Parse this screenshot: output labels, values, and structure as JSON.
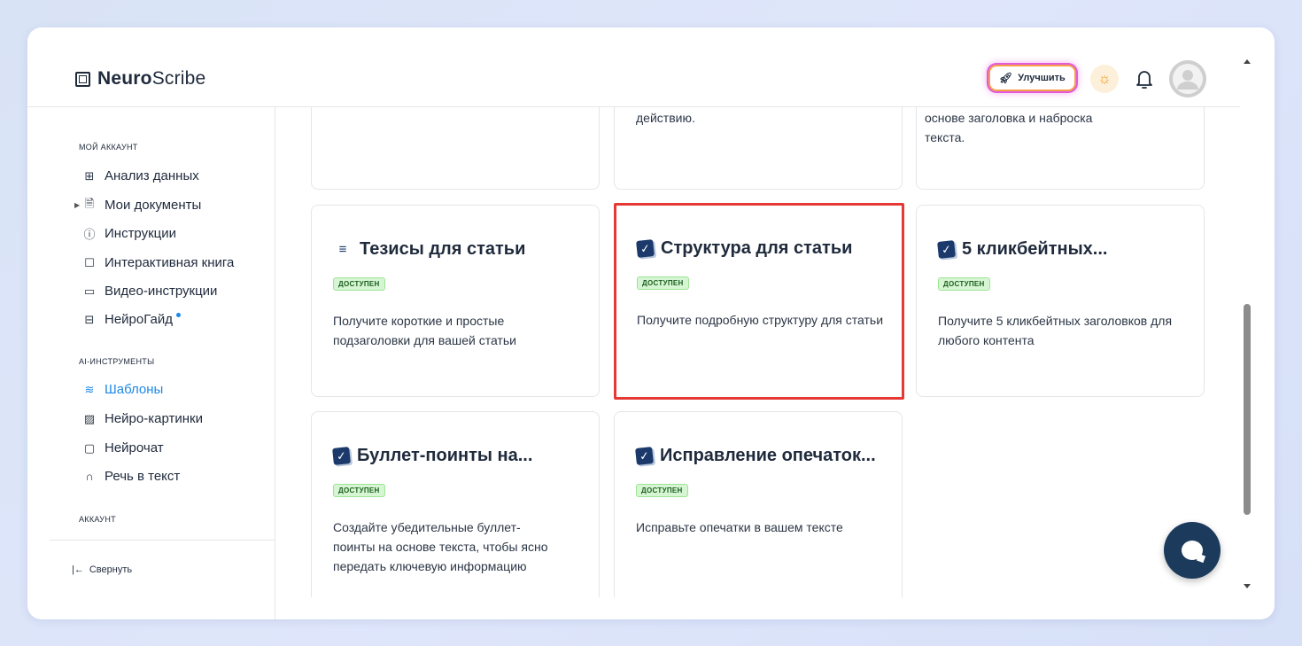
{
  "header": {
    "logo_bold": "Neuro",
    "logo_light": "Scribe",
    "upgrade_label": "Улучшить"
  },
  "sidebar": {
    "section_account": "МОЙ АККАУНТ",
    "items_account": [
      {
        "label": "Анализ данных",
        "icon": "grid-icon"
      },
      {
        "label": "Мои документы",
        "icon": "document-icon"
      },
      {
        "label": "Инструкции",
        "icon": "help-icon"
      },
      {
        "label": "Интерактивная книга",
        "icon": "book-icon"
      },
      {
        "label": "Видео-инструкции",
        "icon": "video-icon"
      },
      {
        "label": "НейроГайд",
        "icon": "guide-icon"
      }
    ],
    "section_ai": "AI-ИНСТРУМЕНТЫ",
    "items_ai": [
      {
        "label": "Шаблоны",
        "icon": "layers-icon",
        "active": true
      },
      {
        "label": "Нейро-картинки",
        "icon": "image-icon"
      },
      {
        "label": "Нейрочат",
        "icon": "chat-icon"
      },
      {
        "label": "Речь в текст",
        "icon": "headphones-icon"
      }
    ],
    "section_acc2": "АККАУНТ",
    "collapse_label": "Свернуть"
  },
  "main": {
    "partial_top": {
      "middle": "действию.",
      "right_line1": "основе заголовка и наброска",
      "right_line2": "текста."
    },
    "cards": [
      {
        "title": "Тезисы для статьи",
        "badge": "ДОСТУПЕН",
        "desc": "Получите короткие и простые подзаголовки для вашей статьи"
      },
      {
        "title": "Структура для статьи",
        "badge": "ДОСТУПЕН",
        "desc": "Получите подробную структуру для статьи"
      },
      {
        "title": "5 кликбейтных...",
        "badge": "ДОСТУПЕН",
        "desc": "Получите 5 кликбейтных заголовков для любого контента"
      },
      {
        "title": "Буллет-поинты на...",
        "badge": "ДОСТУПЕН",
        "desc": "Создайте убедительные буллет-поинты на основе текста, чтобы ясно передать ключевую информацию"
      },
      {
        "title": "Исправление опечаток...",
        "badge": "ДОСТУПЕН",
        "desc": "Исправьте опечатки в вашем тексте"
      }
    ]
  },
  "colors": {
    "accent": "#1e88e5",
    "brand_dark": "#1b3a5c",
    "badge_bg": "#d6f5d2",
    "highlight_border": "#e53935"
  }
}
